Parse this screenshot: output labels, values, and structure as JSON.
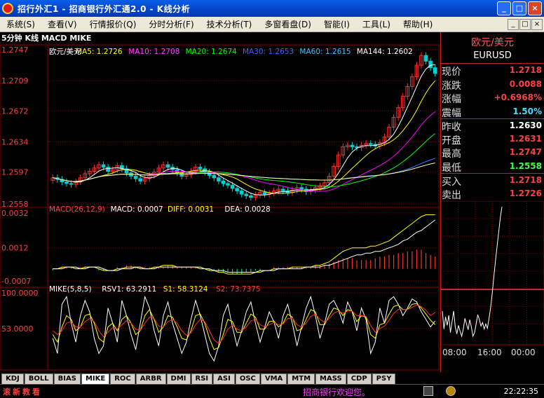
{
  "window": {
    "title": "招行外汇1 - 招商银行外汇通2.0 - K线分析",
    "btn_min": "_",
    "btn_max": "□",
    "btn_close": "×"
  },
  "menu": {
    "items": [
      "系统(S)",
      "查看(V)",
      "行情报价(Q)",
      "分时分析(F)",
      "技术分析(T)",
      "多窗看盘(D)",
      "智能(I)",
      "工具(L)",
      "帮助(H)"
    ],
    "icon_min": "_",
    "icon_restore": "□",
    "icon_close": "×"
  },
  "chart": {
    "header": "5分钟 K线 MACD MIKE",
    "colors": {
      "candle_up": "#ff3030",
      "candle_down": "#00d0d0",
      "ma5": "#ffffff",
      "ma10": "#ffff00",
      "ma20": "#ff00ff",
      "ma30": "#00ff00",
      "ma60": "#3c78ff",
      "ma144": "#ffffa0",
      "grid": "#8b0000"
    },
    "price_legend": [
      {
        "text": "欧元/美元",
        "color": "#ffffff"
      },
      {
        "text": "MA5: 1.2726",
        "color": "#ffff00"
      },
      {
        "text": "MA10: 1.2708",
        "color": "#ff40ff"
      },
      {
        "text": "MA20: 1.2674",
        "color": "#00ff00"
      },
      {
        "text": "MA30: 1.2653",
        "color": "#4060ff"
      },
      {
        "text": "MA60: 1.2615",
        "color": "#40c0ff"
      },
      {
        "text": "MA144: 1.2602",
        "color": "#ffffff"
      }
    ],
    "macd_legend": [
      {
        "text": "MACD(26,12,9)",
        "color": "#ff4040"
      },
      {
        "text": "MACD: 0.0007",
        "color": "#ffffff"
      },
      {
        "text": "DIFF: 0.0031",
        "color": "#ffff00"
      },
      {
        "text": "DEA: 0.0028",
        "color": "#ffffff"
      }
    ],
    "mike_legend": [
      {
        "text": "MIKE(5,8,5)",
        "color": "#ffffff"
      },
      {
        "text": "RSV1: 63.2911",
        "color": "#ffffff"
      },
      {
        "text": "S1: 58.3124",
        "color": "#ffff00"
      },
      {
        "text": "S2: 73.7375",
        "color": "#ff4040"
      }
    ],
    "price_ticks": [
      "1.2747",
      "1.2709",
      "1.2672",
      "1.2634",
      "1.2597",
      "1.2558"
    ],
    "macd_ticks": [
      "0.0032",
      "0.0012",
      "-0.0007"
    ],
    "mike_ticks": [
      "100.0000",
      "53.0000"
    ]
  },
  "chart_data": [
    {
      "type": "candlestick",
      "title": "欧元/美元",
      "ylim": [
        1.2558,
        1.2747
      ],
      "close_series": [
        1.259,
        1.2588,
        1.2585,
        1.2583,
        1.2582,
        1.2585,
        1.259,
        1.2595,
        1.2598,
        1.2602,
        1.2606,
        1.2603,
        1.2598,
        1.26,
        1.2605,
        1.2601,
        1.2596,
        1.2592,
        1.2589,
        1.2586,
        1.2589,
        1.2593,
        1.2597,
        1.2602,
        1.2606,
        1.2603,
        1.26,
        1.2596,
        1.2592,
        1.2594,
        1.2598,
        1.2603,
        1.2601,
        1.2597,
        1.2593,
        1.259,
        1.2586,
        1.2583,
        1.2581,
        1.2577,
        1.2574,
        1.257,
        1.2568,
        1.2566,
        1.2569,
        1.2572,
        1.257,
        1.2571,
        1.2574,
        1.2576,
        1.2574,
        1.2572,
        1.2575,
        1.2578,
        1.2576,
        1.2573,
        1.2575,
        1.2578,
        1.258,
        1.2584,
        1.2592,
        1.2604,
        1.2618,
        1.2628,
        1.263,
        1.2628,
        1.2627,
        1.263,
        1.2632,
        1.2631,
        1.2629,
        1.2633,
        1.264,
        1.2652,
        1.2664,
        1.2676,
        1.269,
        1.2702,
        1.2714,
        1.2728,
        1.274,
        1.2733,
        1.2725,
        1.2718
      ],
      "moving_averages": {
        "MA5": 1.2726,
        "MA10": 1.2708,
        "MA20": 1.2674,
        "MA30": 1.2653,
        "MA60": 1.2615,
        "MA144": 1.2602
      }
    },
    {
      "type": "bar",
      "title": "MACD(26,12,9)",
      "ylim": [
        -0.0007,
        0.0032
      ],
      "series": [
        {
          "name": "MACD",
          "values": [
            -0.0001,
            0.0,
            0.0001,
            0.0001,
            0.0001,
            0.0,
            0.0001,
            0.0001,
            0.0,
            0.0,
            -0.0001,
            -0.0001,
            0.0,
            0.0,
            0.0001,
            0.0001,
            0.0002,
            0.0002,
            0.0001,
            0.0001,
            0.0001,
            0.0001,
            0.0001,
            0.0001,
            0.0001,
            0.0002,
            0.0002,
            0.0001,
            0.0001,
            0.0001,
            0.0001,
            0.0001,
            0.0,
            0.0,
            -0.0001,
            -0.0001,
            -0.0002,
            -0.0002,
            -0.0002,
            -0.0003,
            -0.0003,
            -0.0003,
            -0.0002,
            -0.0002,
            -0.0001,
            -0.0001,
            0.0,
            0.0,
            0.0001,
            0.0001,
            0.0001,
            0.0001,
            0.0001,
            0.0001,
            0.0001,
            0.0001,
            0.0001,
            0.0002,
            0.0002,
            0.0002,
            0.0003,
            0.0004,
            0.0005,
            0.0006,
            0.0006,
            0.0006,
            0.0005,
            0.0005,
            0.0005,
            0.0005,
            0.0006,
            0.0007,
            0.0007,
            0.0008,
            0.0008,
            0.0009,
            0.0009,
            0.001,
            0.001,
            0.0011,
            0.0011,
            0.0009,
            0.0008,
            0.0007
          ]
        },
        {
          "name": "DIFF",
          "values": [
            0.0,
            0.0,
            0.0001,
            0.0001,
            0.0001,
            0.0,
            0.0,
            0.0001,
            0.0001,
            0.0001,
            0.0,
            -0.0001,
            -0.0001,
            -0.0001,
            0.0,
            0.0,
            0.0001,
            0.0001,
            0.0001,
            0.0,
            0.0,
            0.0,
            0.0001,
            0.0001,
            0.0002,
            0.0002,
            0.0002,
            0.0001,
            0.0001,
            0.0001,
            0.0001,
            0.0001,
            0.0,
            0.0,
            -0.0001,
            -0.0001,
            -0.0002,
            -0.0002,
            -0.0003,
            -0.0003,
            -0.0003,
            -0.0003,
            -0.0003,
            -0.0003,
            -0.0002,
            -0.0002,
            -0.0001,
            -0.0001,
            0.0,
            0.0,
            0.0,
            0.0,
            0.0001,
            0.0001,
            0.0001,
            0.0001,
            0.0001,
            0.0002,
            0.0002,
            0.0003,
            0.0004,
            0.0006,
            0.0008,
            0.001,
            0.0011,
            0.0012,
            0.0012,
            0.0012,
            0.0012,
            0.0013,
            0.0013,
            0.0014,
            0.0015,
            0.0016,
            0.0018,
            0.002,
            0.0022,
            0.0024,
            0.0026,
            0.0028,
            0.003,
            0.0031,
            0.0031,
            0.0031
          ]
        },
        {
          "name": "DEA",
          "values": [
            0.0,
            0.0,
            0.0,
            0.0001,
            0.0001,
            0.0001,
            0.0,
            0.0,
            0.0001,
            0.0001,
            0.0001,
            0.0,
            -0.0001,
            -0.0001,
            -0.0001,
            0.0,
            0.0,
            0.0,
            0.0001,
            0.0001,
            0.0,
            0.0,
            0.0,
            0.0001,
            0.0001,
            0.0001,
            0.0001,
            0.0001,
            0.0001,
            0.0001,
            0.0001,
            0.0001,
            0.0001,
            0.0,
            0.0,
            -0.0001,
            -0.0001,
            -0.0001,
            -0.0002,
            -0.0002,
            -0.0002,
            -0.0002,
            -0.0002,
            -0.0002,
            -0.0002,
            -0.0001,
            -0.0001,
            -0.0001,
            -0.0001,
            0.0,
            0.0,
            0.0,
            0.0,
            0.0,
            0.0,
            0.0001,
            0.0001,
            0.0001,
            0.0001,
            0.0002,
            0.0002,
            0.0003,
            0.0004,
            0.0005,
            0.0006,
            0.0007,
            0.0008,
            0.0008,
            0.0009,
            0.0009,
            0.001,
            0.001,
            0.0011,
            0.0012,
            0.0013,
            0.0014,
            0.0016,
            0.0017,
            0.0019,
            0.0021,
            0.0022,
            0.0024,
            0.0026,
            0.0028
          ]
        }
      ]
    },
    {
      "type": "line",
      "title": "MIKE(5,8,5)",
      "ylim": [
        0,
        100
      ],
      "series": [
        {
          "name": "RSV1",
          "values": [
            40,
            20,
            85,
            95,
            60,
            35,
            70,
            90,
            75,
            40,
            20,
            30,
            80,
            60,
            35,
            90,
            70,
            45,
            25,
            60,
            95,
            80,
            50,
            30,
            70,
            88,
            60,
            40,
            20,
            35,
            65,
            90,
            70,
            45,
            20,
            10,
            30,
            70,
            85,
            55,
            30,
            50,
            75,
            88,
            60,
            35,
            55,
            75,
            62,
            40,
            70,
            85,
            60,
            30,
            55,
            80,
            95,
            70,
            40,
            60,
            85,
            90,
            78,
            60,
            88,
            75,
            50,
            80,
            65,
            20,
            35,
            80,
            60,
            90,
            95,
            85,
            70,
            80,
            92,
            88,
            75,
            65,
            55,
            63
          ]
        },
        {
          "name": "S1",
          "values": [
            45,
            35,
            55,
            70,
            65,
            50,
            55,
            70,
            72,
            60,
            40,
            35,
            55,
            60,
            50,
            65,
            70,
            60,
            45,
            50,
            70,
            78,
            65,
            48,
            55,
            70,
            68,
            55,
            40,
            38,
            50,
            70,
            72,
            60,
            40,
            25,
            28,
            45,
            65,
            62,
            48,
            48,
            60,
            72,
            68,
            52,
            52,
            62,
            63,
            55,
            60,
            72,
            68,
            50,
            52,
            65,
            78,
            75,
            58,
            58,
            70,
            80,
            78,
            70,
            78,
            76,
            62,
            70,
            68,
            45,
            40,
            58,
            60,
            72,
            82,
            84,
            78,
            78,
            85,
            86,
            80,
            72,
            64,
            58
          ]
        },
        {
          "name": "S2",
          "values": [
            50,
            45,
            50,
            60,
            62,
            55,
            55,
            62,
            66,
            62,
            50,
            42,
            48,
            54,
            52,
            58,
            63,
            60,
            52,
            50,
            60,
            68,
            66,
            56,
            55,
            62,
            65,
            60,
            50,
            44,
            47,
            58,
            65,
            62,
            50,
            38,
            33,
            40,
            52,
            57,
            52,
            50,
            55,
            63,
            65,
            58,
            55,
            58,
            61,
            58,
            59,
            66,
            67,
            58,
            55,
            60,
            69,
            72,
            65,
            61,
            66,
            73,
            76,
            73,
            76,
            76,
            70,
            70,
            69,
            57,
            48,
            53,
            56,
            64,
            73,
            78,
            78,
            78,
            81,
            84,
            82,
            77,
            70,
            74
          ]
        }
      ]
    },
    {
      "type": "line",
      "title": "EURUSD",
      "x": [
        "08:00",
        "16:00",
        "00:00"
      ],
      "ylim": [
        1.2558,
        1.2747
      ],
      "values": [
        1.26,
        1.2575,
        1.2592,
        1.258,
        1.2594,
        1.257,
        1.2585,
        1.26,
        1.2578,
        1.2568,
        1.258,
        1.2572,
        1.2565,
        1.2575,
        1.259,
        1.2582,
        1.2574,
        1.2588,
        1.2578,
        1.2565,
        1.257,
        1.2582,
        1.2595,
        1.2588,
        1.2579,
        1.2584,
        1.2575,
        1.2582,
        1.2576,
        1.259,
        1.2605,
        1.2625,
        1.2648,
        1.267,
        1.269,
        1.271,
        1.273,
        1.2745
      ]
    }
  ],
  "quote_panel": {
    "title": "欧元/美元",
    "code": "EURUSD",
    "rows": [
      {
        "label": "现价",
        "value": "1.2718",
        "color": "#ff4040"
      },
      {
        "label": "涨跌",
        "value": "0.0088",
        "color": "#ff4040"
      },
      {
        "label": "涨幅",
        "value": "+0.6968%",
        "color": "#ff4040"
      },
      {
        "label": "震幅",
        "value": "1.50%",
        "color": "#40e0ff"
      },
      {
        "label": "昨收",
        "value": "1.2630",
        "color": "#ffffff"
      },
      {
        "label": "开盘",
        "value": "1.2631",
        "color": "#ff4040"
      },
      {
        "label": "最高",
        "value": "1.2747",
        "color": "#ff4040"
      },
      {
        "label": "最低",
        "value": "1.2558",
        "color": "#40ff40"
      },
      {
        "label": "买入",
        "value": "1.2718",
        "color": "#ff4040"
      },
      {
        "label": "卖出",
        "value": "1.2726",
        "color": "#ff4040"
      }
    ],
    "time_labels": [
      "08:00",
      "16:00",
      "00:00"
    ]
  },
  "tabs": [
    "KDJ",
    "BOLL",
    "BIAS",
    "MIKE",
    "ROC",
    "ARBR",
    "DMI",
    "RSI",
    "ASI",
    "OSC",
    "VMA",
    "MTM",
    "MASS",
    "CDP",
    "PSY"
  ],
  "active_tab": "MIKE",
  "status": {
    "left": "滚新教看",
    "marquee": "招商银行欢迎您。",
    "time": "22:22:35"
  }
}
